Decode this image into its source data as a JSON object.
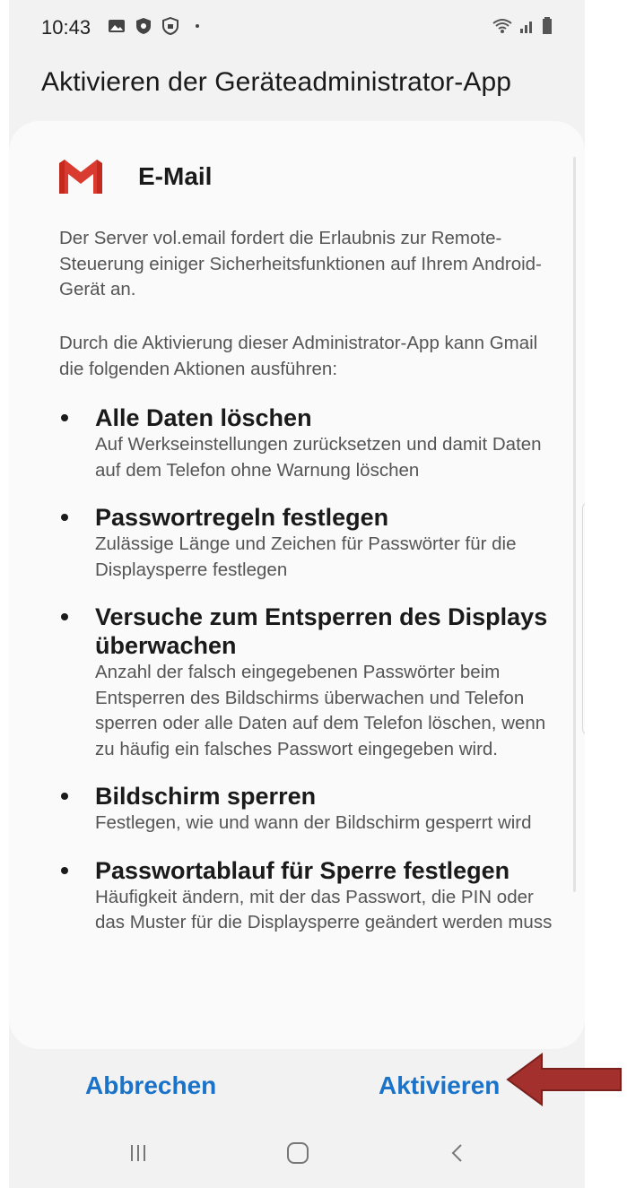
{
  "status_bar": {
    "time": "10:43"
  },
  "header": {
    "title": "Aktivieren der Geräteadministrator-App"
  },
  "app": {
    "name": "E-Mail",
    "icon": "gmail-icon"
  },
  "content": {
    "intro": "Der Server vol.email fordert die Erlaubnis zur Remote-Steuerung einiger Sicherheitsfunktionen auf Ihrem Android-Gerät an.",
    "actions_intro": "Durch die Aktivierung dieser Administrator-App kann Gmail die folgenden Aktionen ausführen:"
  },
  "permissions": [
    {
      "title": "Alle Daten löschen",
      "desc": "Auf Werkseinstellungen zurücksetzen und damit Daten auf dem Telefon ohne Warnung löschen"
    },
    {
      "title": "Passwortregeln festlegen",
      "desc": "Zulässige Länge und Zeichen für Passwörter für die Displaysperre festlegen"
    },
    {
      "title": "Versuche zum Entsperren des Displays überwachen",
      "desc": "Anzahl der falsch eingegebenen Passwörter beim Entsperren des Bildschirms überwachen und Telefon sperren oder alle Daten auf dem Telefon löschen, wenn zu häufig ein falsches Passwort eingegeben wird."
    },
    {
      "title": "Bildschirm sperren",
      "desc": "Festlegen, wie und wann der Bildschirm gesperrt wird"
    },
    {
      "title": "Passwortablauf für Sperre festlegen",
      "desc": "Häufigkeit ändern, mit der das Passwort, die PIN oder das Muster für die Displaysperre geändert werden muss"
    }
  ],
  "buttons": {
    "cancel": "Abbrechen",
    "activate": "Aktivieren"
  },
  "colors": {
    "accent": "#1a73c9",
    "arrow": "#a3302c",
    "gmail_red": "#d93b30"
  }
}
